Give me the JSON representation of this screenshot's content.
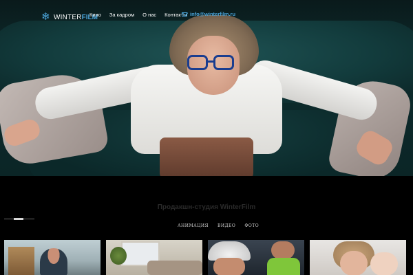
{
  "header": {
    "logo": {
      "text_a": "WINTER",
      "text_b": "FILM",
      "icon": "snowflake-icon"
    },
    "nav": [
      {
        "label": "Кино"
      },
      {
        "label": "За кадром"
      },
      {
        "label": "О нас"
      },
      {
        "label": "Контакты"
      }
    ],
    "email": {
      "icon": "mail-icon",
      "text": "info@winterfilm.ru"
    }
  },
  "hero": {
    "image": "woman in white shirt and blue glasses lying on a dark teal sofa"
  },
  "studio": {
    "title": "Продакшн-студия WinterFilm"
  },
  "filters": [
    {
      "label": "АНИМАЦИЯ"
    },
    {
      "label": "ВИДЕО"
    },
    {
      "label": "ФОТО"
    }
  ],
  "slider": {
    "active_index": 1,
    "count": 3
  },
  "colors": {
    "accent": "#4aa3d8",
    "background": "#000000",
    "title_dim": "#2a2a2a"
  }
}
